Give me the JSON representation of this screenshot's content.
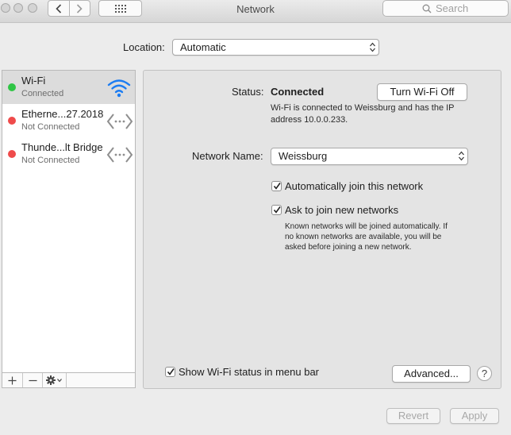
{
  "window": {
    "title": "Network"
  },
  "search": {
    "placeholder": "Search"
  },
  "location": {
    "label": "Location:",
    "value": "Automatic"
  },
  "services": [
    {
      "name": "Wi-Fi",
      "status": "Connected",
      "status_color": "#2fc545",
      "icon": "wifi-icon",
      "selected": true
    },
    {
      "name": "Etherne...27.2018",
      "status": "Not Connected",
      "status_color": "#ef4b4b",
      "icon": "ethernet-icon",
      "selected": false
    },
    {
      "name": "Thunde...lt Bridge",
      "status": "Not Connected",
      "status_color": "#ef4b4b",
      "icon": "ethernet-icon",
      "selected": false
    }
  ],
  "sidebar_toolbar": {
    "add": "+",
    "remove": "−"
  },
  "detail": {
    "status_label": "Status:",
    "status_value": "Connected",
    "turn_off_button": "Turn Wi-Fi Off",
    "status_desc_line1": "Wi-Fi is connected to Weissburg and has the IP",
    "status_desc_line2": "address 10.0.0.233.",
    "network_name_label": "Network Name:",
    "network_name_value": "Weissburg",
    "auto_join_label": "Automatically join this network",
    "ask_join_label": "Ask to join new networks",
    "ask_desc_line1": "Known networks will be joined automatically. If",
    "ask_desc_line2": "no known networks are available, you will be",
    "ask_desc_line3": "asked before joining a new network.",
    "show_status_label": "Show Wi-Fi status in menu bar",
    "advanced_button": "Advanced...",
    "help_button": "?"
  },
  "footer": {
    "revert_button": "Revert",
    "apply_button": "Apply"
  },
  "colors": {
    "wifi_blue": "#1b7cf2",
    "connected_green": "#2fc545",
    "disconnected_red": "#ef4b4b"
  }
}
